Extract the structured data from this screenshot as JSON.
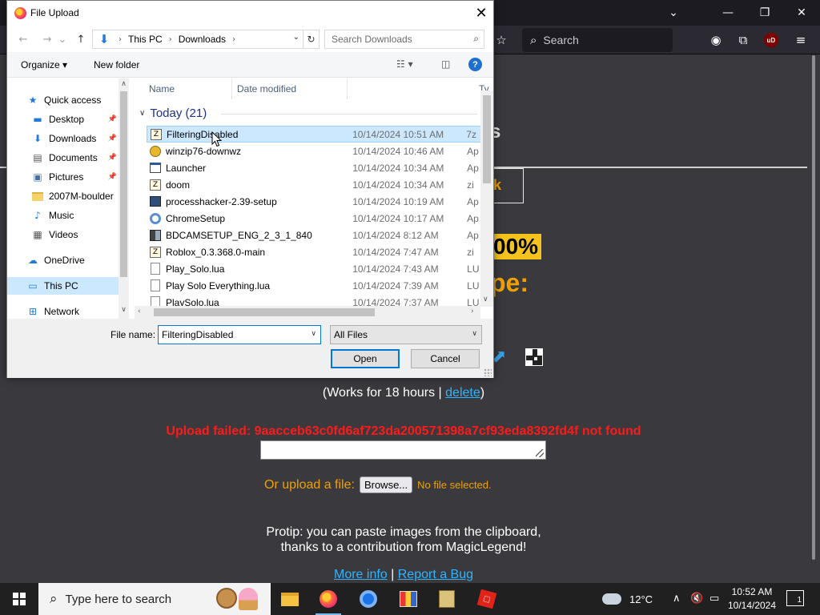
{
  "browser": {
    "search_placeholder": "Search",
    "ublock_label": "uD"
  },
  "page": {
    "title_fragment": "s",
    "box_fragment": "k",
    "percent_fragment": "00%",
    "type_fragment": "pe:",
    "works_prefix": "(Works for 18 hours | ",
    "works_link": "delete",
    "works_suffix": ")",
    "upload_failed": "Upload failed: 9aacceb63c0fd6af723da200571398a7cf93eda8392fd4f not found",
    "or_upload_label": "Or upload a file:",
    "browse_label": "Browse...",
    "no_file_label": "No file selected.",
    "protip_line1": "Protip: you can paste images from the clipboard,",
    "protip_line2": "thanks to a contribution from MagicLegend!",
    "more_info_link": "More info",
    "link_separator": " | ",
    "report_bug_link": "Report a Bug"
  },
  "dialog": {
    "title": "File Upload",
    "breadcrumbs": [
      "This PC",
      "Downloads"
    ],
    "search_placeholder": "Search Downloads",
    "organize_label": "Organize",
    "new_folder_label": "New folder",
    "help_label": "?",
    "nav_items": [
      {
        "label": "Quick access",
        "icon": "star-icon",
        "pinned": false
      },
      {
        "label": "Desktop",
        "icon": "desktop-icon",
        "pinned": true
      },
      {
        "label": "Downloads",
        "icon": "download-icon",
        "pinned": true
      },
      {
        "label": "Documents",
        "icon": "documents-icon",
        "pinned": true
      },
      {
        "label": "Pictures",
        "icon": "pictures-icon",
        "pinned": true
      },
      {
        "label": "2007M-boulder",
        "icon": "folder-icon",
        "pinned": false
      },
      {
        "label": "Music",
        "icon": "music-icon",
        "pinned": false
      },
      {
        "label": "Videos",
        "icon": "videos-icon",
        "pinned": false
      },
      {
        "label": "OneDrive",
        "icon": "cloud-icon",
        "pinned": false
      },
      {
        "label": "This PC",
        "icon": "computer-icon",
        "pinned": false
      },
      {
        "label": "Network",
        "icon": "network-icon",
        "pinned": false
      }
    ],
    "columns": {
      "name": "Name",
      "date": "Date modified",
      "type": "Ty"
    },
    "group_label": "Today (21)",
    "files": [
      {
        "name": "FilteringDisabled",
        "date": "10/14/2024 10:51 AM",
        "type": "7z",
        "icon": "zip-file-icon"
      },
      {
        "name": "winzip76-downwz",
        "date": "10/14/2024 10:46 AM",
        "type": "Ap",
        "icon": "installer-icon"
      },
      {
        "name": "Launcher",
        "date": "10/14/2024 10:34 AM",
        "type": "Ap",
        "icon": "application-icon"
      },
      {
        "name": "doom",
        "date": "10/14/2024 10:34 AM",
        "type": "zi",
        "icon": "zip-file-icon"
      },
      {
        "name": "processhacker-2.39-setup",
        "date": "10/14/2024 10:19 AM",
        "type": "Ap",
        "icon": "setup-icon"
      },
      {
        "name": "ChromeSetup",
        "date": "10/14/2024 10:17 AM",
        "type": "Ap",
        "icon": "chrome-setup-icon"
      },
      {
        "name": "BDCAMSETUP_ENG_2_3_1_840",
        "date": "10/14/2024 8:12 AM",
        "type": "Ap",
        "icon": "setup-icon"
      },
      {
        "name": "Roblox_0.3.368.0-main",
        "date": "10/14/2024 7:47 AM",
        "type": "zi",
        "icon": "zip-file-icon"
      },
      {
        "name": "Play_Solo.lua",
        "date": "10/14/2024 7:43 AM",
        "type": "LU",
        "icon": "file-icon"
      },
      {
        "name": "Play Solo Everything.lua",
        "date": "10/14/2024 7:39 AM",
        "type": "LU",
        "icon": "file-icon"
      },
      {
        "name": "PlaySolo.lua",
        "date": "10/14/2024 7:37 AM",
        "type": "LU",
        "icon": "file-icon"
      }
    ],
    "file_name_label": "File name:",
    "file_name_value": "FilteringDisabled",
    "file_type_value": "All Files",
    "open_label": "Open",
    "cancel_label": "Cancel"
  },
  "taskbar": {
    "search_placeholder": "Type here to search",
    "temperature": "12°C",
    "time": "10:52 AM",
    "date": "10/14/2024",
    "notification_count": "1"
  }
}
